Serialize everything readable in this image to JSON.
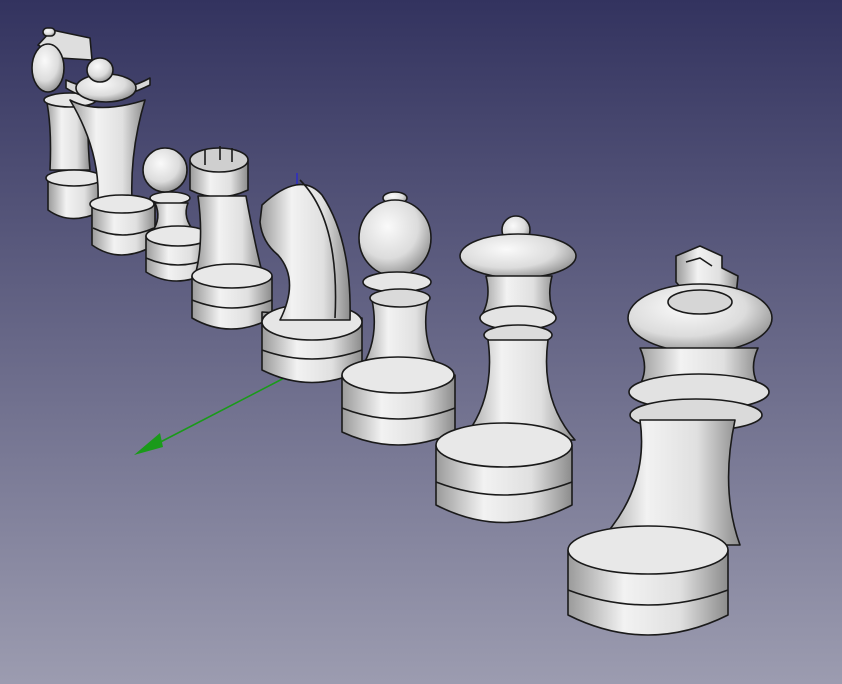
{
  "viewport": {
    "background_top": "#33335f",
    "background_bottom": "#9c9cb0"
  },
  "model": {
    "piece_fill_light": "#f4f4f4",
    "piece_fill_dark": "#8a8a8a",
    "outline": "#1a1a1a"
  },
  "axes": {
    "x_axis_color": "#1a9a1a",
    "z_axis_color": "#2a2acc"
  },
  "pieces": [
    {
      "name": "bishop-back"
    },
    {
      "name": "queen-back"
    },
    {
      "name": "pawn"
    },
    {
      "name": "rook"
    },
    {
      "name": "knight"
    },
    {
      "name": "bishop"
    },
    {
      "name": "queen"
    },
    {
      "name": "king"
    }
  ]
}
